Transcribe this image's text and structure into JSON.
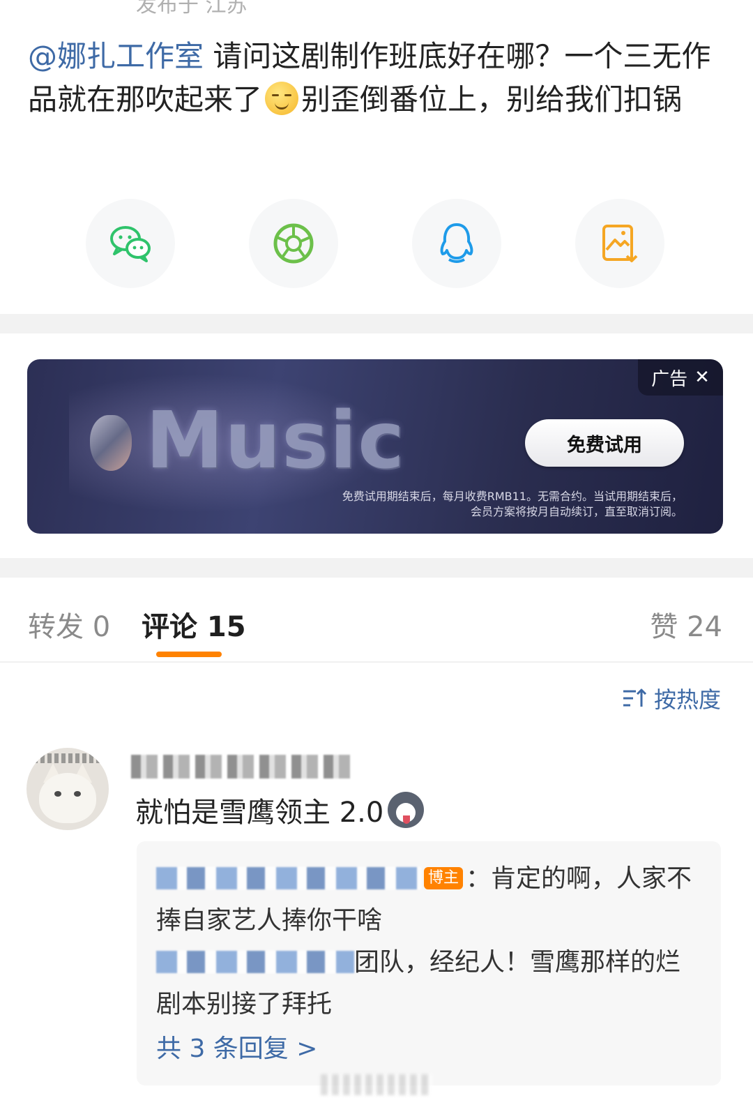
{
  "post": {
    "posted_meta": "发布于 江苏",
    "mention": "@娜扎工作室",
    "text_part1": " 请问这剧制作班底好在哪？一个三无作品就在那吹起来了",
    "text_part2": "别歪倒番位上，别给我们扣锅"
  },
  "share": {
    "items": [
      {
        "icon": "wechat-icon",
        "color": "#2fc36b"
      },
      {
        "icon": "moments-icon",
        "color": "#6cc04a"
      },
      {
        "icon": "qq-icon",
        "color": "#1e9be9"
      },
      {
        "icon": "save-image-icon",
        "color": "#f5a623"
      }
    ]
  },
  "ad": {
    "tag": "广告",
    "close": "✕",
    "brand_text": "Music",
    "cta": "免费试用",
    "fine_print_1": "免费试用期结束后，每月收费RMB11。无需合约。当试用期结束后，",
    "fine_print_2": "会员方案将按月自动续订，直至取消订阅。"
  },
  "tabs": {
    "repost": "转发 0",
    "comments": "评论 15",
    "likes": "赞 24",
    "accent_color": "#ff8200"
  },
  "sort": {
    "label": "按热度"
  },
  "comment": {
    "text": "就怕是雪鹰领主 2.0",
    "replies": [
      {
        "badge": "博主",
        "text": "：肯定的啊，人家不捧自家艺人捧你干啥"
      },
      {
        "text": "团队，经纪人！雪鹰那样的烂剧本别接了拜托"
      }
    ],
    "more_replies": "共 3 条回复 >"
  }
}
